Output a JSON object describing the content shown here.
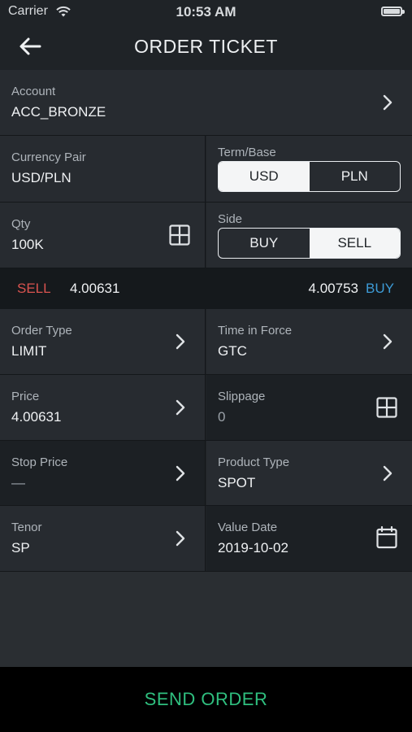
{
  "status_bar": {
    "carrier": "Carrier",
    "time": "10:53 AM",
    "icons": [
      "wifi-icon",
      "battery-icon"
    ]
  },
  "header": {
    "title": "ORDER TICKET",
    "back_icon": "arrow-left-icon"
  },
  "account": {
    "label": "Account",
    "value": "ACC_BRONZE"
  },
  "currency_pair": {
    "label": "Currency Pair",
    "value": "USD/PLN"
  },
  "term_base": {
    "label": "Term/Base",
    "options": [
      "USD",
      "PLN"
    ],
    "selected": "USD"
  },
  "qty": {
    "label": "Qty",
    "value": "100K",
    "icon": "keypad-icon"
  },
  "side": {
    "label": "Side",
    "options": [
      "BUY",
      "SELL"
    ],
    "selected": "SELL"
  },
  "quote": {
    "sell_label": "SELL",
    "sell_price": "4.00631",
    "buy_price": "4.00753",
    "buy_label": "BUY"
  },
  "order_type": {
    "label": "Order Type",
    "value": "LIMIT"
  },
  "time_in_force": {
    "label": "Time in Force",
    "value": "GTC"
  },
  "price": {
    "label": "Price",
    "value": "4.00631"
  },
  "slippage": {
    "label": "Slippage",
    "value": "0",
    "icon": "keypad-icon"
  },
  "stop_price": {
    "label": "Stop Price",
    "value": "—"
  },
  "product_type": {
    "label": "Product Type",
    "value": "SPOT"
  },
  "tenor": {
    "label": "Tenor",
    "value": "SP"
  },
  "value_date": {
    "label": "Value Date",
    "value": "2019-10-02",
    "icon": "calendar-icon"
  },
  "footer": {
    "send_label": "SEND ORDER"
  },
  "colors": {
    "sell": "#d9534f",
    "buy": "#3d9bd6",
    "send": "#2fbf7f",
    "background": "#272b30"
  }
}
